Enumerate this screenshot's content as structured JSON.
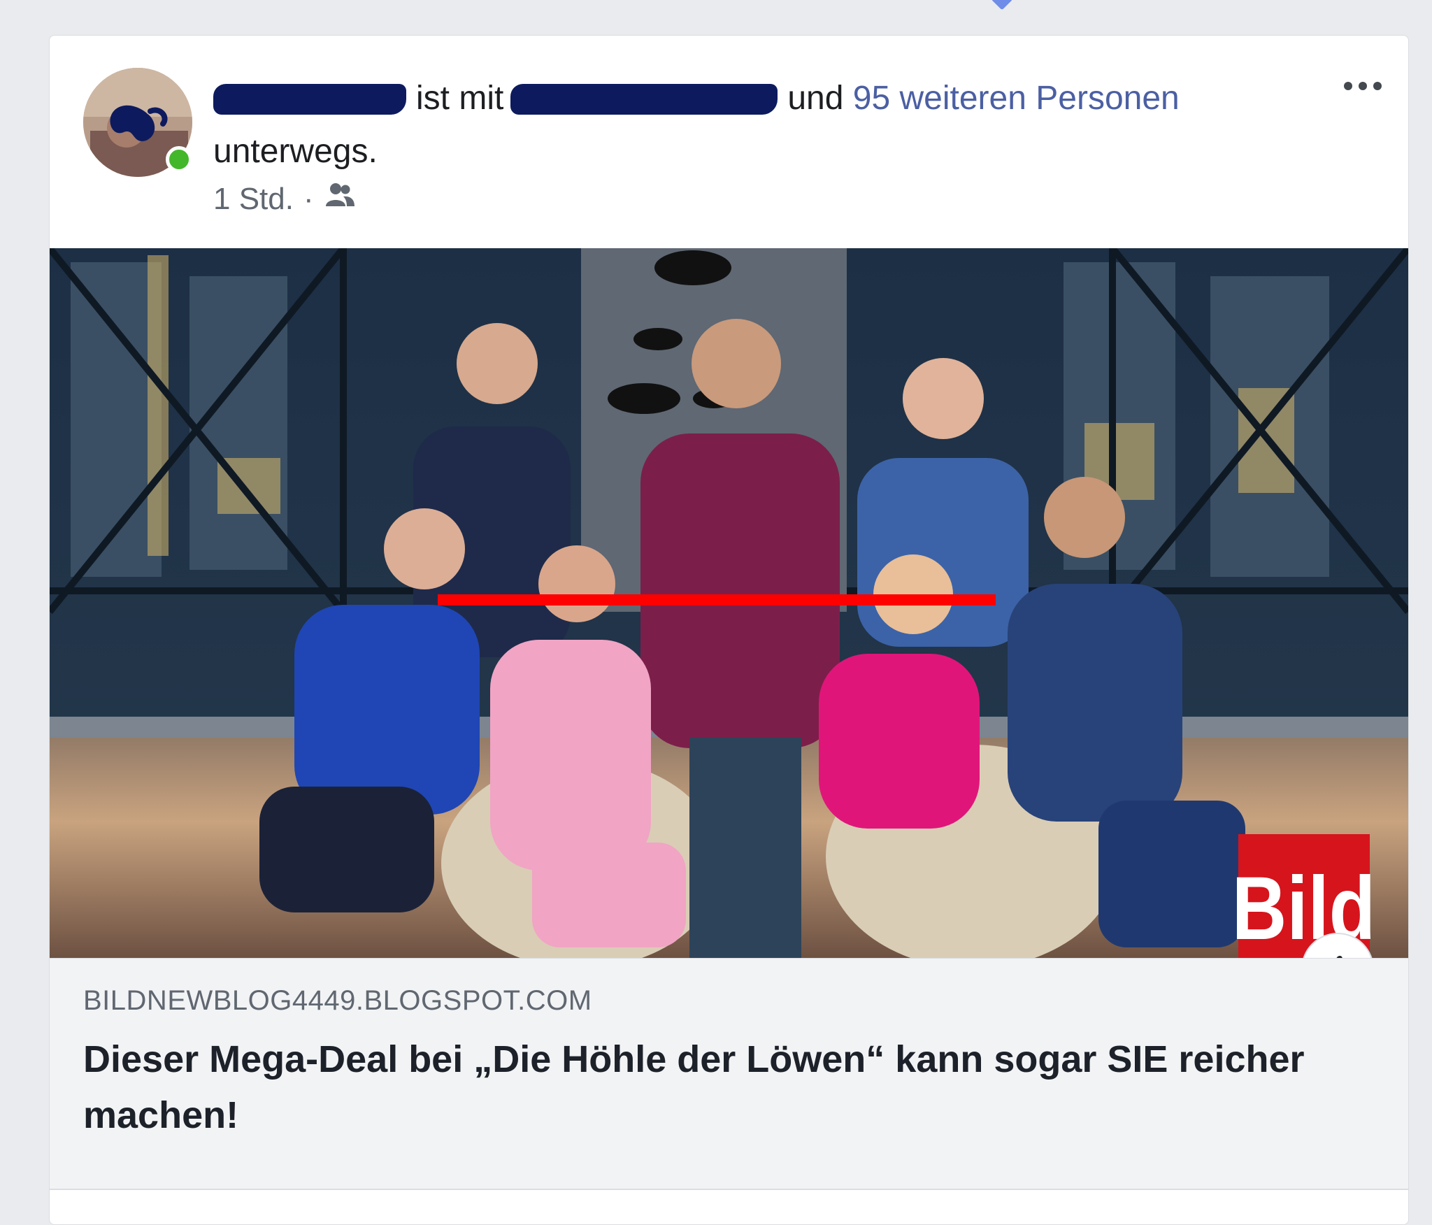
{
  "post": {
    "author_redacted": true,
    "headline_text_1": "ist mit",
    "headline_text_2": "und",
    "headline_link": "95 weiteren Personen",
    "headline_text_3": "unterwegs.",
    "timestamp": "1 Std.",
    "audience_icon": "people-icon",
    "menu_icon": "more-options-icon"
  },
  "image": {
    "logo_text": "Bild",
    "info_icon_glyph": "i"
  },
  "preview": {
    "domain": "BILDNEWBLOG4449.BLOGSPOT.COM",
    "title": "Dieser Mega-Deal bei „Die Höhle der Löwen“ kann sogar SIE reicher machen!"
  },
  "colors": {
    "redaction": "#0d1b5e",
    "link": "#4b5fa3",
    "online": "#42b72a",
    "bild_red": "#d6141c",
    "annotation_line": "#ff0000"
  }
}
